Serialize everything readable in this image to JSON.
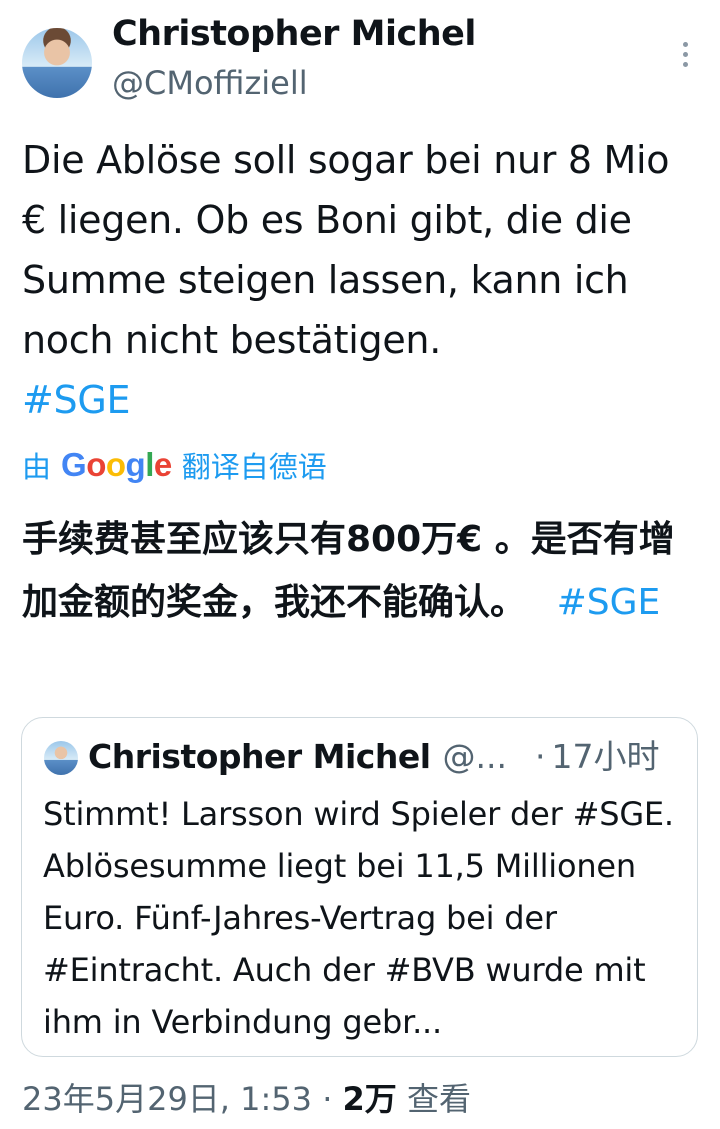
{
  "author": {
    "name": "Christopher Michel",
    "handle": "@CMoffiziell"
  },
  "tweet": {
    "text": "Die Ablöse soll sogar bei nur 8 Mio € liegen. Ob es Boni gibt, die die Summe steigen lassen, kann ich noch nicht bestätigen.",
    "hashtag": "#SGE"
  },
  "translation": {
    "prefix": "由",
    "provider": "Google",
    "suffix": "翻译自德语",
    "text": "手续费甚至应该只有800万€ 。是否有增加金额的奖金，我还不能确认。",
    "hashtag": "#SGE"
  },
  "quoted_tweet": {
    "name": "Christopher Michel",
    "handle": "@...",
    "separator": "·",
    "time": "17小时",
    "text": "Stimmt! Larsson wird Spieler der #SGE. Ablösesumme liegt bei 11,5 Millionen Euro. Fünf-Jahres-Vertrag bei der #Eintracht. Auch der #BVB wurde mit ihm in Verbindung gebr..."
  },
  "meta": {
    "timestamp": "23年5月29日, 1:53",
    "separator": "·",
    "views_count": "2万",
    "views_label": "查看"
  },
  "icons": {
    "more": "more-vertical-icon"
  },
  "colors": {
    "link": "#1d9bf0",
    "secondary_text": "#536471",
    "border": "#cfd9de"
  }
}
